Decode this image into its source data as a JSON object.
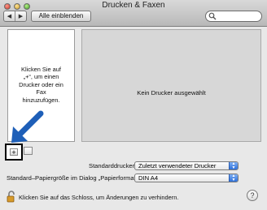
{
  "window": {
    "title": "Drucken & Faxen"
  },
  "toolbar": {
    "back_label": "◀",
    "forward_label": "▶",
    "show_all_label": "Alle einblenden",
    "search_placeholder": ""
  },
  "printer_list": {
    "hint_lines": [
      "Klicken Sie auf",
      "„+“, um einen",
      "Drucker oder ein",
      "Fax",
      "hinzuzufügen."
    ]
  },
  "detail": {
    "empty_text": "Kein Drucker ausgewählt"
  },
  "add_button": {
    "label": "+"
  },
  "default_printer": {
    "label": "Standarddrucker:",
    "value": "Zuletzt verwendeter Drucker"
  },
  "paper_size": {
    "label": "Standard–Papiergröße im Dialog „Papierformat“:",
    "value": "DIN A4"
  },
  "lock": {
    "text": "Klicken Sie auf das Schloss, um Änderungen zu verhindern."
  },
  "help": {
    "label": "?"
  },
  "colors": {
    "arrow": "#1e5fb8",
    "popup_accent": "#2d6fd8"
  }
}
